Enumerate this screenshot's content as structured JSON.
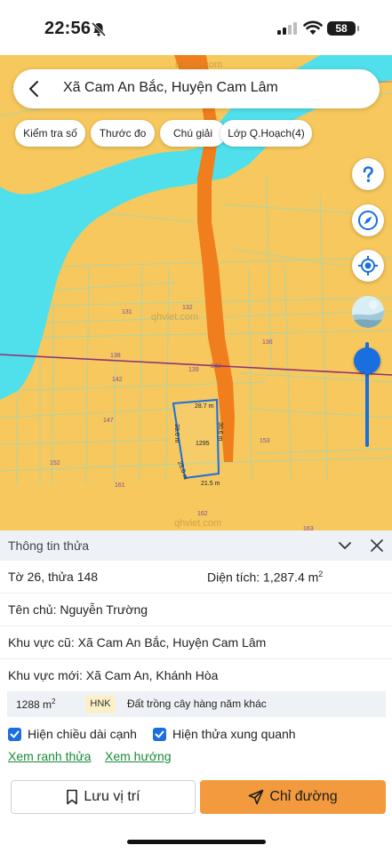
{
  "status_bar": {
    "time": "22:56",
    "battery": "58",
    "icons": [
      "bell-off-icon",
      "signal-icon",
      "wifi-icon",
      "battery-icon"
    ]
  },
  "header": {
    "title": "Xã Cam An Bắc, Huyện Cam Lâm",
    "back_icon": "chevron-left-icon"
  },
  "chips": [
    "Kiểm tra số",
    "Thước đo",
    "Chú giải",
    "Lớp Q.Hoạch(4)"
  ],
  "map": {
    "watermark": "qhviet.com",
    "parcel_labels": [
      "131",
      "132",
      "136",
      "138",
      "139",
      "242",
      "142",
      "147",
      "153",
      "152",
      "161",
      "162",
      "163"
    ],
    "parcel_area": "1295",
    "edge_top": "28.7 m",
    "edge_left": "23.0 m",
    "edge_lower_left": "25.0 m",
    "edge_right": "30.6 m",
    "edge_bottom": "21.5 m",
    "colors": {
      "land": "#f6c85d",
      "water": "#4fe0ec",
      "road": "#f07e1c",
      "boundary": "#8e2f78",
      "parcel": "#1a6fe0"
    }
  },
  "side_buttons": [
    "help-icon",
    "compass-icon",
    "locate-icon",
    "layers-icon"
  ],
  "panel": {
    "title": "Thông tin thửa",
    "sheet": "Tờ 26, thửa 148",
    "area_label": "Diện tích: 1,287.4 m",
    "area_unit_sup": "2",
    "owner": "Tên chủ: Nguyễn Trường",
    "old_area": "Khu vực cũ: Xã Cam An Bắc, Huyện Cam Lâm",
    "new_area": "Khu vực mới: Xã Cam An, Khánh Hòa",
    "use_area": "1288 m",
    "use_area_sup": "2",
    "use_code": "HNK",
    "use_name": "Đất trồng cây hàng năm khác",
    "check_lengths": "Hiện chiều dài cạnh",
    "check_neighbors": "Hiện thửa xung quanh",
    "link_boundary": "Xem ranh thửa",
    "link_direction": "Xem hướng",
    "btn_save": "Lưu vị trí",
    "btn_route": "Chỉ đường"
  }
}
